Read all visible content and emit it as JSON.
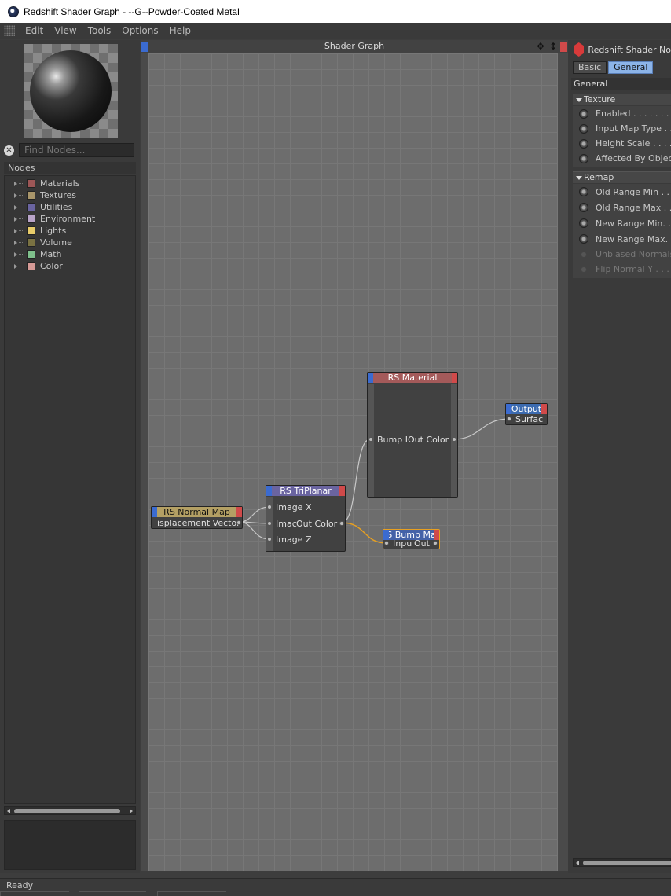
{
  "window": {
    "title": "Redshift Shader Graph - --G--Powder-Coated Metal"
  },
  "menu": [
    "Edit",
    "View",
    "Tools",
    "Options",
    "Help"
  ],
  "left": {
    "find_placeholder": "Find Nodes...",
    "nodes_header": "Nodes",
    "categories": [
      {
        "label": "Materials",
        "color": "#9c5656"
      },
      {
        "label": "Textures",
        "color": "#a8956a"
      },
      {
        "label": "Utilities",
        "color": "#6a64a0"
      },
      {
        "label": "Environment",
        "color": "#b9a4c9"
      },
      {
        "label": "Lights",
        "color": "#e8cc6a"
      },
      {
        "label": "Volume",
        "color": "#7a7242"
      },
      {
        "label": "Math",
        "color": "#7fc08c"
      },
      {
        "label": "Color",
        "color": "#d69a96"
      }
    ]
  },
  "graph": {
    "title": "Shader Graph",
    "nodes": {
      "material": {
        "title": "RS Material",
        "head_color": "#a45a5a",
        "in_port": "Bump I",
        "out_port": "Out Color"
      },
      "output": {
        "title": "Output",
        "head_color": "#3c6bb0",
        "in_port": "Surfac"
      },
      "triplanar": {
        "title": "RS TriPlanar",
        "head_color": "#6a64a0",
        "in_x": "Image X",
        "in_y": "Imac",
        "out_port": "Out Color",
        "in_z": "Image Z"
      },
      "normal_map": {
        "title": "RS Normal Map",
        "head_color": "#b4a064",
        "out_port": "isplacement Vector"
      },
      "bump_map": {
        "title": "S Bump Ma",
        "head_color": "#4462a8",
        "in_port": "Inpu",
        "out_port": "Out"
      }
    },
    "wire_highlight": "#e8a020"
  },
  "attributes": {
    "title": "Redshift Shader No",
    "tabs": [
      "Basic",
      "General"
    ],
    "section": "General",
    "texture_group": {
      "label": "Texture",
      "props": [
        "Enabled . . . . . . . .",
        "Input Map Type . .",
        "Height Scale . . . .",
        "Affected By Object"
      ]
    },
    "remap_group": {
      "label": "Remap",
      "props": [
        "Old Range Min . . .",
        "Old Range Max . .",
        "New Range Min. . .",
        "New Range Max. . .",
        "Unbiased Normals",
        "Flip Normal Y . . . ."
      ]
    }
  },
  "status": "Ready"
}
